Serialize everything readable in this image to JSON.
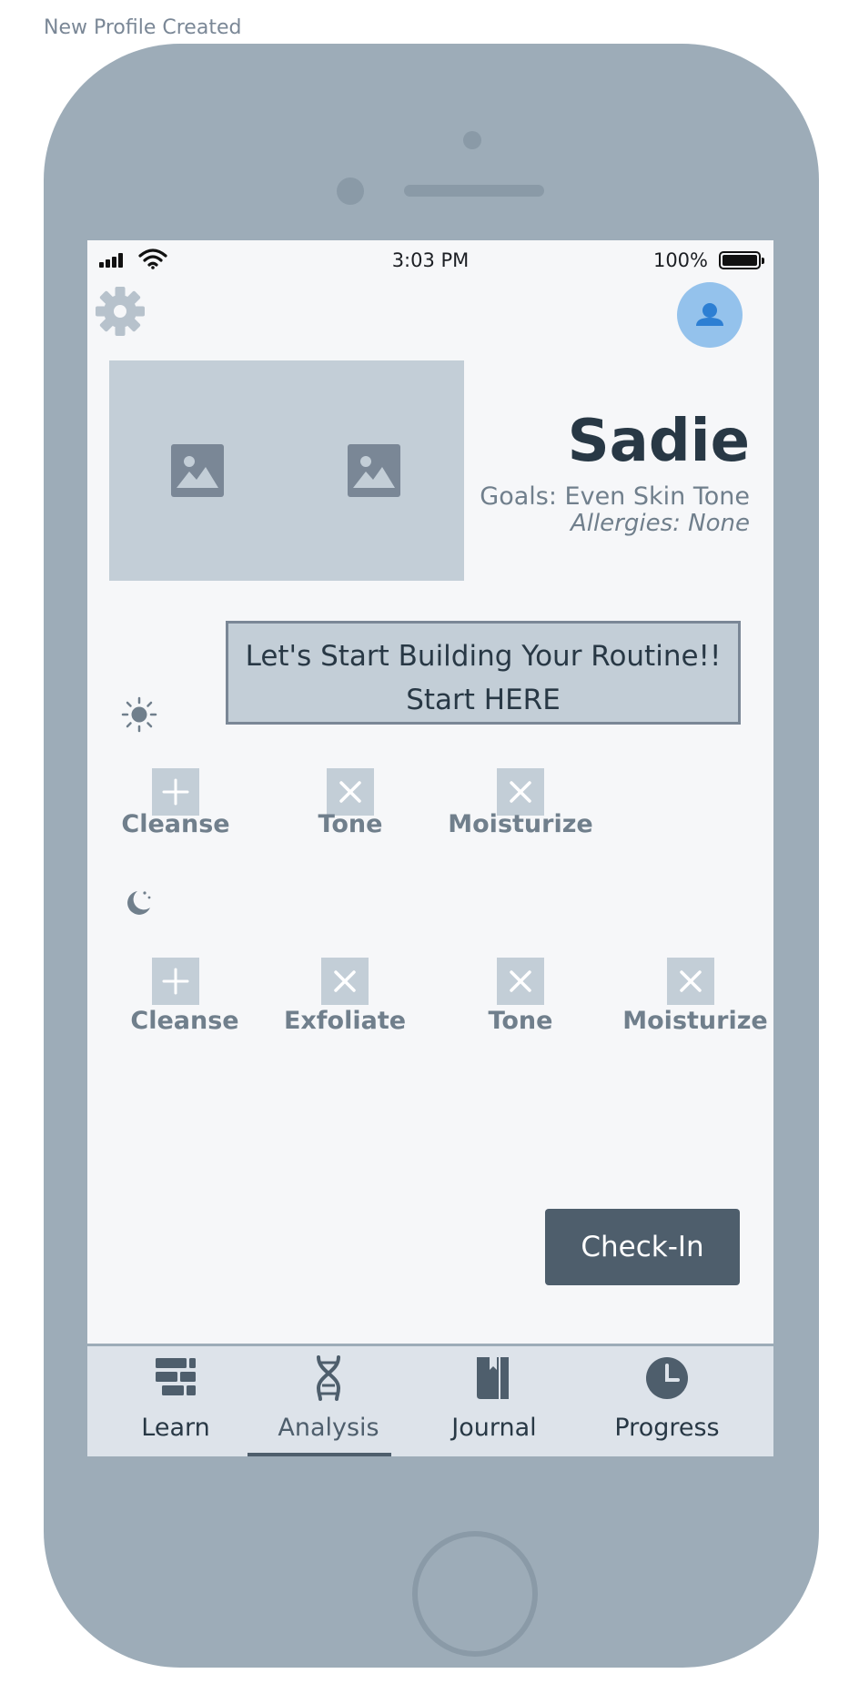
{
  "caption": "New Profile Created",
  "status_bar": {
    "time": "3:03 PM",
    "battery": "100%"
  },
  "profile": {
    "name": "Sadie",
    "goals": "Goals: Even Skin Tone",
    "allergies": "Allergies: None"
  },
  "cta": {
    "line1": "Let's Start Building Your Routine!!",
    "line2": "Start HERE"
  },
  "morning_routine": [
    {
      "label": "Cleanse",
      "action": "add"
    },
    {
      "label": "Tone",
      "action": "remove"
    },
    {
      "label": "Moisturize",
      "action": "remove"
    }
  ],
  "night_routine": [
    {
      "label": "Cleanse",
      "action": "add"
    },
    {
      "label": "Exfoliate",
      "action": "remove"
    },
    {
      "label": "Tone",
      "action": "remove"
    },
    {
      "label": "Moisturize",
      "action": "remove"
    }
  ],
  "checkin_label": "Check-In",
  "tabs": [
    {
      "label": "Learn",
      "icon": "books-icon"
    },
    {
      "label": "Analysis",
      "icon": "dna-icon",
      "active": true
    },
    {
      "label": "Journal",
      "icon": "journal-icon"
    },
    {
      "label": "Progress",
      "icon": "clock-icon"
    }
  ],
  "colors": {
    "device": "#9dacb8",
    "screen": "#f6f7f9",
    "placeholder": "#c3ced7",
    "avatar": "#94c2ec",
    "avatar_icon": "#2d7fd3",
    "primary_button": "#4e5e6c",
    "heading_text": "#283845",
    "muted_text": "#707f8c",
    "tab_bar": "#dde3ea"
  }
}
